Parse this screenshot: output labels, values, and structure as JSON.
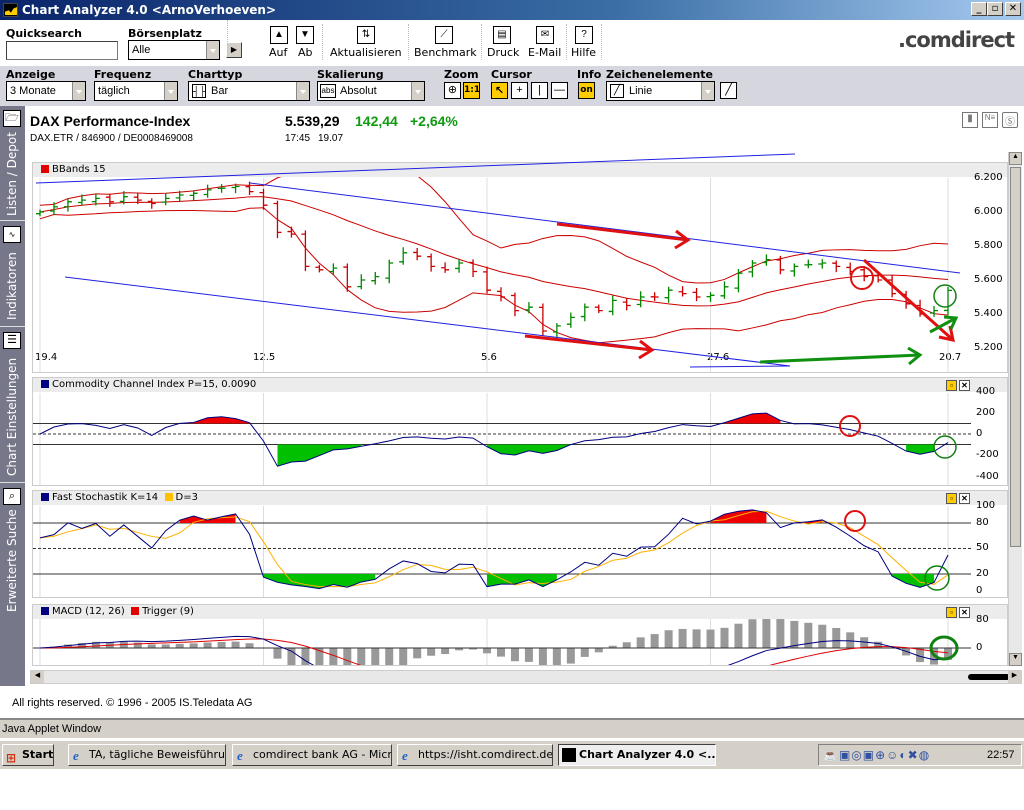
{
  "window": {
    "title": "Chart Analyzer 4.0  <ArnoVerhoeven>",
    "buttons": [
      "_",
      "▫",
      "✕"
    ]
  },
  "toolbar1": {
    "quicksearch_label": "Quicksearch",
    "quicksearch_value": "",
    "boersenplatz_label": "Börsenplatz",
    "boersenplatz_value": "Alle",
    "auf": "Auf",
    "ab": "Ab",
    "aktualisieren": "Aktualisieren",
    "benchmark": "Benchmark",
    "druck": "Druck",
    "email": "E-Mail",
    "hilfe": "Hilfe",
    "logo": ".comdirect"
  },
  "toolbar2": {
    "anzeige_label": "Anzeige",
    "anzeige_value": "3 Monate",
    "frequenz_label": "Frequenz",
    "frequenz_value": "täglich",
    "charttyp_label": "Charttyp",
    "charttyp_value": "Bar",
    "skalierung_label": "Skalierung",
    "skalierung_value": "Absolut",
    "skalierung_icon_text": "abs",
    "zoom_label": "Zoom",
    "zoom_reset": "1:1",
    "cursor_label": "Cursor",
    "info_label": "Info",
    "info_value": "on",
    "zeichen_label": "Zeichenelemente",
    "zeichen_value": "Linie"
  },
  "sidebar": [
    "Listen / Depot",
    "Indikatoren",
    "Chart Einstellungen",
    "Erweiterte Suche"
  ],
  "header": {
    "name": "DAX Performance-Index",
    "ids": "DAX.ETR  /  846900  /  DE0008469008",
    "price": "5.539,29",
    "change": "142,44",
    "change_pct": "+2,64%",
    "time": "17:45",
    "date": "19.07",
    "up_color": "#119911"
  },
  "panels": {
    "main": {
      "title": "BBands 15",
      "yticks": [
        "6.200",
        "6.000",
        "5.800",
        "5.600",
        "5.400",
        "5.200"
      ],
      "xticks": [
        "19.4",
        "12.5",
        "5.6",
        "27.6",
        "20.7"
      ]
    },
    "cci": {
      "title": "Commodity Channel Index P=15, 0.0090",
      "yticks": [
        "400",
        "200",
        "0",
        "-200",
        "-400"
      ]
    },
    "stoch": {
      "title": "Fast Stochastik K=14",
      "title2": "D=3",
      "yticks": [
        "100",
        "80",
        "50",
        "20",
        "0"
      ]
    },
    "macd": {
      "title": "MACD (12, 26)",
      "title2": "Trigger (9)",
      "yticks": [
        "80",
        "0"
      ]
    }
  },
  "chart_data": {
    "type": "bar",
    "title": "DAX Performance-Index",
    "xlabel": "",
    "ylabel": "",
    "ylim": [
      5150,
      6250
    ],
    "x_labels": {
      "0": "19.4",
      "16": "12.5",
      "32": "5.6",
      "48": "27.6",
      "65": "20.7"
    },
    "close": [
      6000,
      6030,
      6060,
      6070,
      6080,
      6060,
      6090,
      6070,
      6050,
      6080,
      6100,
      6110,
      6130,
      6140,
      6150,
      6120,
      6040,
      5880,
      5870,
      5680,
      5660,
      5670,
      5560,
      5600,
      5620,
      5700,
      5760,
      5740,
      5680,
      5660,
      5700,
      5650,
      5540,
      5500,
      5420,
      5440,
      5300,
      5330,
      5380,
      5440,
      5420,
      5480,
      5450,
      5500,
      5500,
      5540,
      5520,
      5500,
      5510,
      5560,
      5640,
      5700,
      5720,
      5660,
      5680,
      5690,
      5700,
      5680,
      5650,
      5620,
      5600,
      5520,
      5460,
      5400,
      5420,
      5539
    ]
  },
  "footer": "All rights reserved. © 1996 - 2005 IS.Teledata AG",
  "applet_status": "Java Applet Window",
  "taskbar": {
    "start": "Start",
    "tasks": [
      "TA, tägliche Beweisführu...",
      "comdirect bank AG - Micr...",
      "https://isht.comdirect.de...",
      "Chart Analyzer 4.0  <..."
    ],
    "clock": "22:57"
  }
}
